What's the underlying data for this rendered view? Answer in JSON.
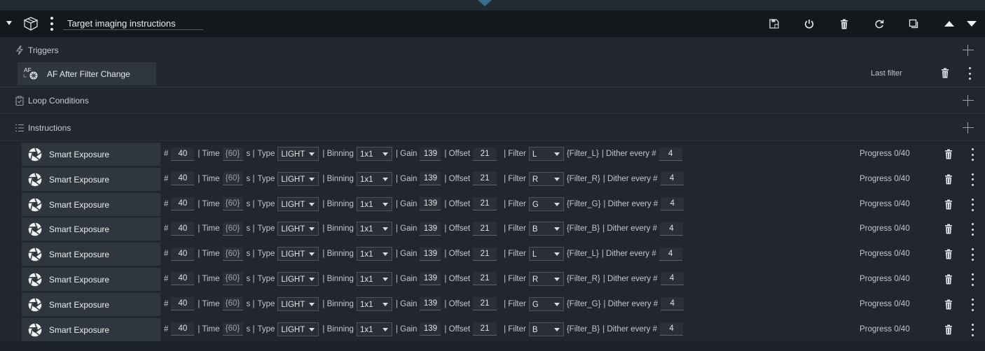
{
  "header": {
    "title": "Target imaging instructions"
  },
  "sections": {
    "triggers": "Triggers",
    "loop_conditions": "Loop Conditions",
    "instructions": "Instructions"
  },
  "trigger": {
    "label": "AF After Filter Change",
    "icon_text": "AF",
    "info": "Last filter"
  },
  "instructions": [
    {
      "name": "Smart Exposure",
      "count": "40",
      "time": "{60}",
      "type": "LIGHT",
      "binning": "1x1",
      "gain": "139",
      "offset": "21",
      "filter": "L",
      "filter_var": "{Filter_L}",
      "dither": "4",
      "progress": "Progress 0/40"
    },
    {
      "name": "Smart Exposure",
      "count": "40",
      "time": "{60}",
      "type": "LIGHT",
      "binning": "1x1",
      "gain": "139",
      "offset": "21",
      "filter": "R",
      "filter_var": "{Filter_R}",
      "dither": "4",
      "progress": "Progress 0/40"
    },
    {
      "name": "Smart Exposure",
      "count": "40",
      "time": "{60}",
      "type": "LIGHT",
      "binning": "1x1",
      "gain": "139",
      "offset": "21",
      "filter": "G",
      "filter_var": "{Filter_G}",
      "dither": "4",
      "progress": "Progress 0/40"
    },
    {
      "name": "Smart Exposure",
      "count": "40",
      "time": "{60}",
      "type": "LIGHT",
      "binning": "1x1",
      "gain": "139",
      "offset": "21",
      "filter": "B",
      "filter_var": "{Filter_B}",
      "dither": "4",
      "progress": "Progress 0/40"
    },
    {
      "name": "Smart Exposure",
      "count": "40",
      "time": "{60}",
      "type": "LIGHT",
      "binning": "1x1",
      "gain": "139",
      "offset": "21",
      "filter": "L",
      "filter_var": "{Filter_L}",
      "dither": "4",
      "progress": "Progress 0/40"
    },
    {
      "name": "Smart Exposure",
      "count": "40",
      "time": "{60}",
      "type": "LIGHT",
      "binning": "1x1",
      "gain": "139",
      "offset": "21",
      "filter": "R",
      "filter_var": "{Filter_R}",
      "dither": "4",
      "progress": "Progress 0/40"
    },
    {
      "name": "Smart Exposure",
      "count": "40",
      "time": "{60}",
      "type": "LIGHT",
      "binning": "1x1",
      "gain": "139",
      "offset": "21",
      "filter": "G",
      "filter_var": "{Filter_G}",
      "dither": "4",
      "progress": "Progress 0/40"
    },
    {
      "name": "Smart Exposure",
      "count": "40",
      "time": "{60}",
      "type": "LIGHT",
      "binning": "1x1",
      "gain": "139",
      "offset": "21",
      "filter": "B",
      "filter_var": "{Filter_B}",
      "dither": "4",
      "progress": "Progress 0/40"
    }
  ],
  "param_labels": {
    "hash": "#",
    "time": "| Time",
    "seconds": "s |",
    "type": "Type",
    "binning": "| Binning",
    "gain": "| Gain",
    "offset": "| Offset",
    "filter": "| Filter",
    "dither": "| Dither every #"
  },
  "colors": {
    "background": "#1c2128",
    "header": "#14171b",
    "row": "#22272d",
    "card": "#30363d",
    "accent": "#3b6e8c"
  },
  "icons": {
    "header": [
      "collapse-caret-icon",
      "box-icon",
      "kebab-icon",
      "save-icon",
      "power-icon",
      "trash-icon",
      "refresh-icon",
      "copy-icon",
      "move-up-icon",
      "move-down-icon"
    ],
    "sections": [
      "lightning-icon",
      "clipboard-check-icon",
      "list-icon",
      "add-icon"
    ],
    "rows": [
      "aperture-icon",
      "trash-icon",
      "kebab-icon"
    ]
  }
}
